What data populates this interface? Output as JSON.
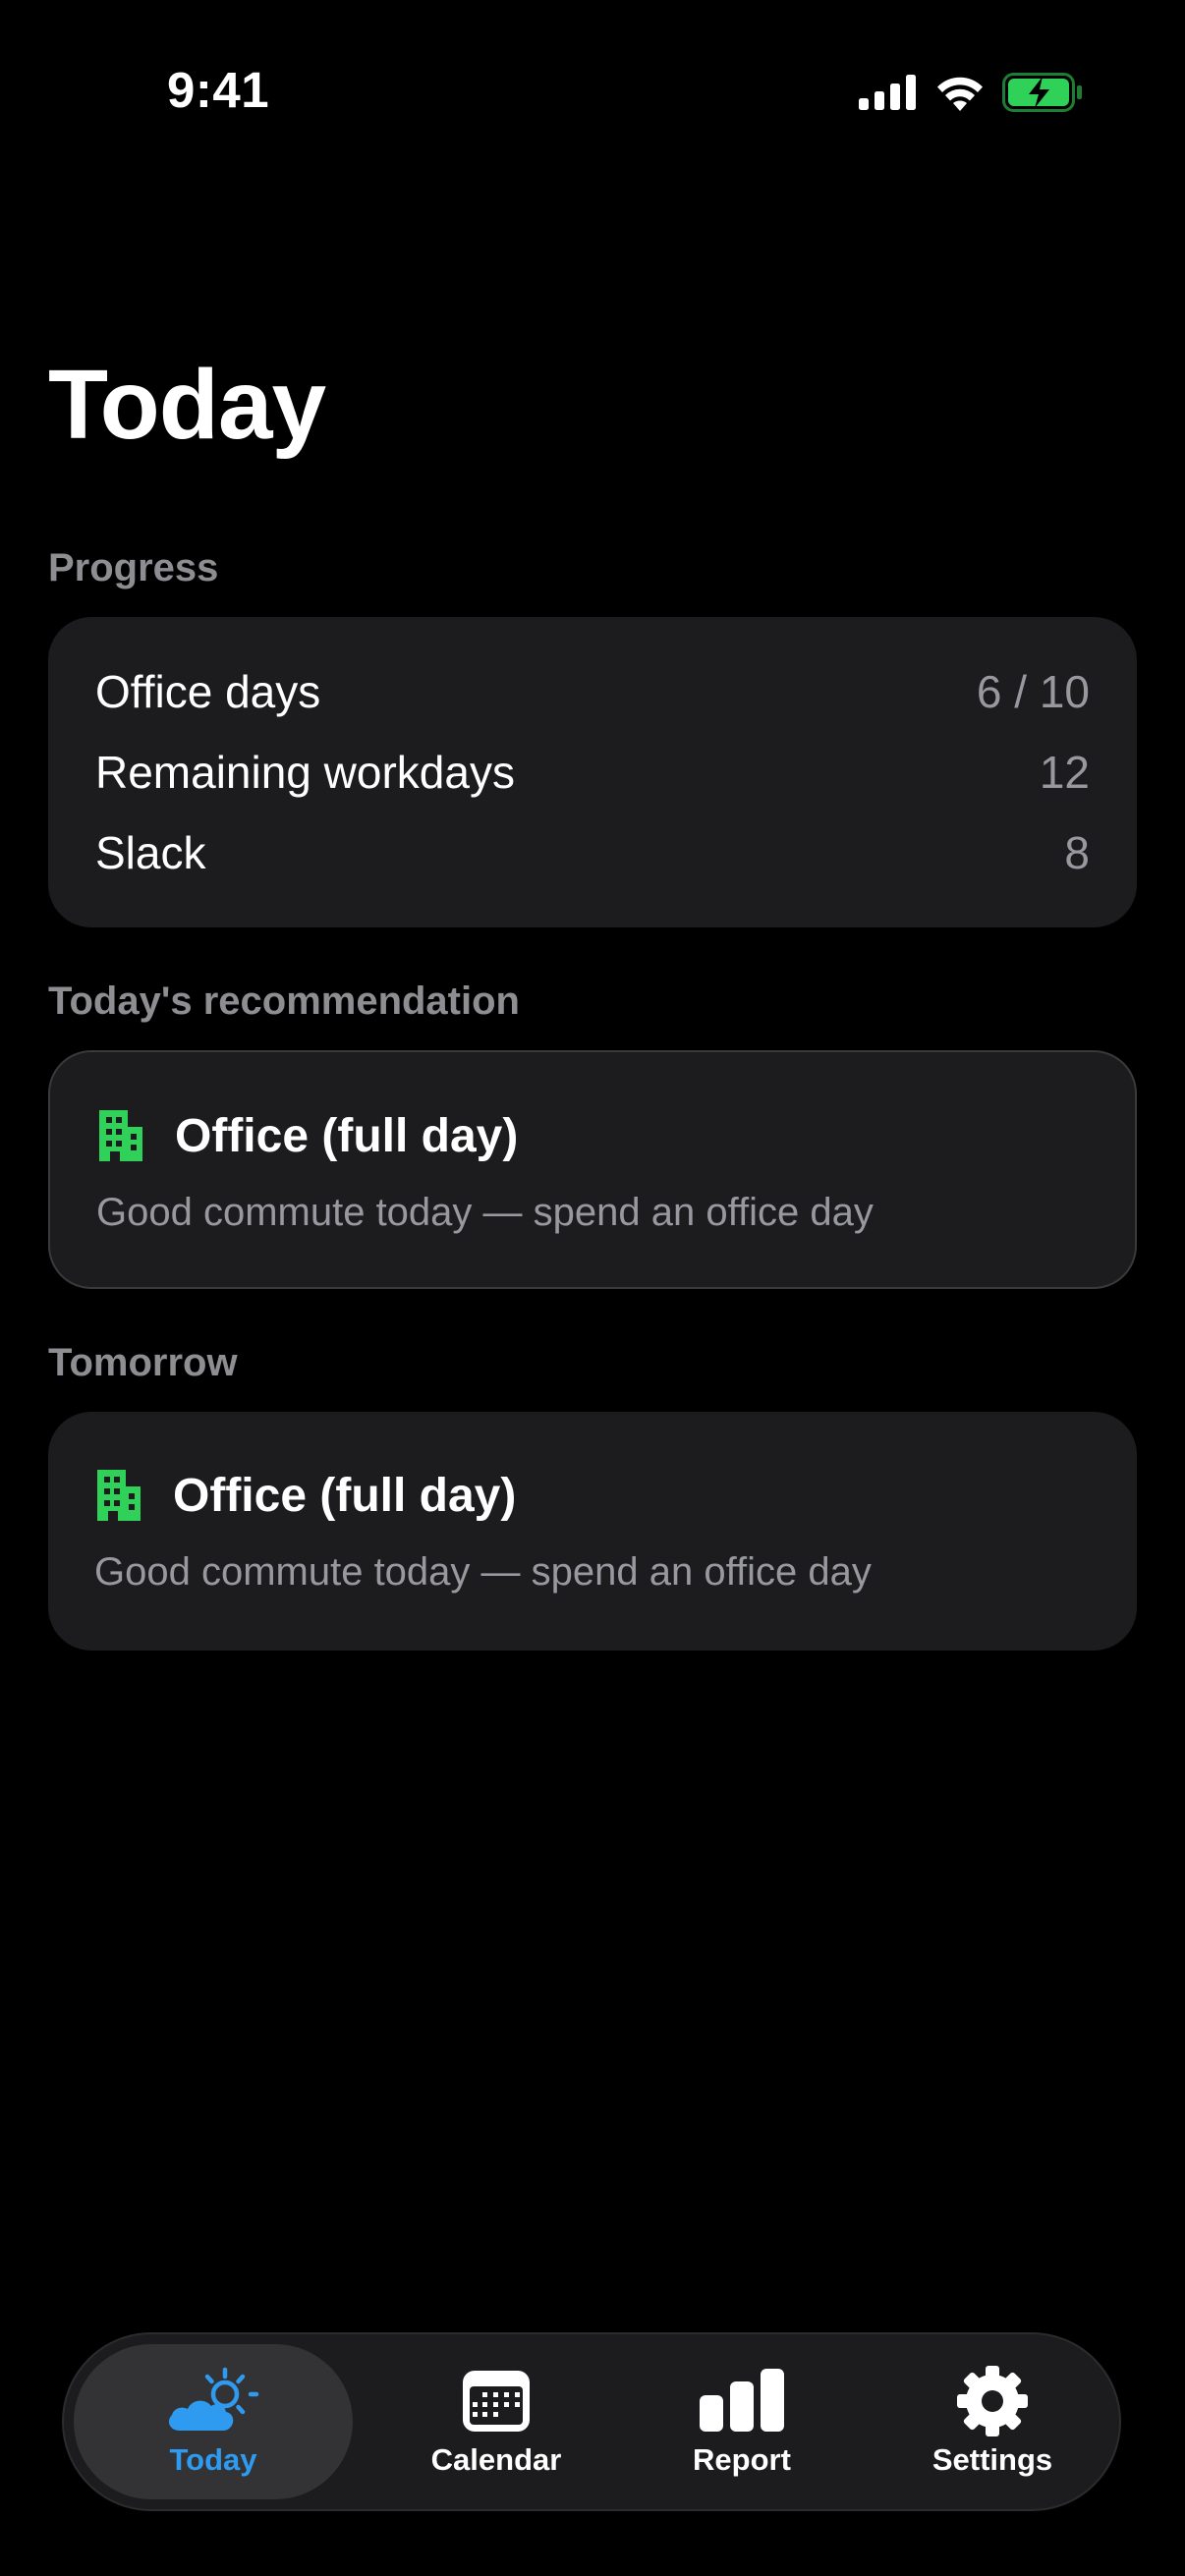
{
  "status_bar": {
    "time": "9:41",
    "icons": [
      "cellular-signal-icon",
      "wifi-icon",
      "battery-charging-icon"
    ]
  },
  "page": {
    "title": "Today"
  },
  "progress": {
    "header": "Progress",
    "rows": [
      {
        "label": "Office days",
        "value": "6 / 10"
      },
      {
        "label": "Remaining workdays",
        "value": "12"
      },
      {
        "label": "Slack",
        "value": "8"
      }
    ]
  },
  "recommendation": {
    "header": "Today's recommendation",
    "icon": "building-icon",
    "title": "Office (full day)",
    "subtitle": "Good commute today — spend an office day"
  },
  "tomorrow": {
    "header": "Tomorrow",
    "icon": "building-icon",
    "title": "Office (full day)",
    "subtitle": "Good commute today — spend an office day"
  },
  "tab_bar": {
    "tabs": [
      {
        "label": "Today",
        "icon": "weather-sun-cloud-icon",
        "active": true
      },
      {
        "label": "Calendar",
        "icon": "calendar-icon",
        "active": false
      },
      {
        "label": "Report",
        "icon": "bar-chart-icon",
        "active": false
      },
      {
        "label": "Settings",
        "icon": "gear-icon",
        "active": false
      }
    ]
  },
  "colors": {
    "background": "#000000",
    "card": "#1c1c1e",
    "secondary_text": "#98989f",
    "section_header": "#8d8d92",
    "accent": "#2e9bf0",
    "building_green": "#30d158",
    "battery_green": "#30d158"
  }
}
